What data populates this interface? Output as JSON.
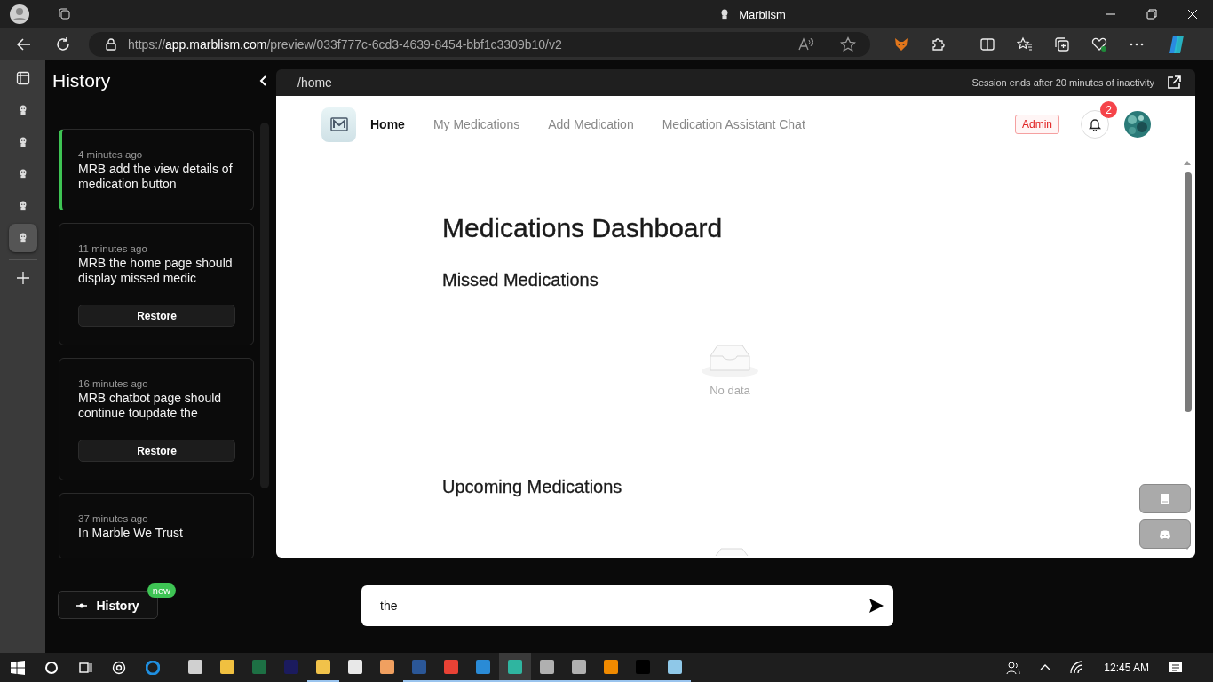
{
  "browser": {
    "tab_title": "Marblism",
    "url": {
      "scheme": "https://",
      "host": "app.marblism.com",
      "path": "/preview/033f777c-6cd3-4639-8454-bbf1c3309b10/v2"
    }
  },
  "vertical_tabs": [
    {
      "selected": false
    },
    {
      "selected": false
    },
    {
      "selected": false
    },
    {
      "selected": false
    },
    {
      "selected": true
    }
  ],
  "history": {
    "title": "History",
    "items": [
      {
        "time": "4 minutes ago",
        "text": "MRB add the view details of medication button",
        "selected": true
      },
      {
        "time": "11 minutes ago",
        "text": "MRB the home page should display missed medic",
        "selected": false,
        "button": "Restore"
      },
      {
        "time": "16 minutes ago",
        "text": "MRB chatbot page should continue toupdate the",
        "selected": false,
        "button": "Restore"
      },
      {
        "time": "37 minutes ago",
        "text": "In Marble We Trust",
        "selected": false
      }
    ]
  },
  "preview": {
    "path": "/home",
    "session_note": "Session ends after 20 minutes of inactivity",
    "nav": [
      {
        "label": "Home",
        "selected": true
      },
      {
        "label": "My Medications",
        "selected": false
      },
      {
        "label": "Add Medication",
        "selected": false
      },
      {
        "label": "Medication Assistant Chat",
        "selected": false
      }
    ],
    "role_badge": "Admin",
    "notification_count": "2",
    "title": "Medications Dashboard",
    "sections": [
      {
        "heading": "Missed Medications",
        "empty_text": "No data"
      },
      {
        "heading": "Upcoming Medications"
      }
    ]
  },
  "history_button": {
    "label": "History",
    "badge": "new"
  },
  "chat": {
    "value": "the"
  },
  "taskbar": {
    "apps": [
      {
        "kind": "calculator",
        "running": false,
        "selected": false
      },
      {
        "kind": "store",
        "running": false,
        "selected": false
      },
      {
        "kind": "excel",
        "running": false,
        "selected": false
      },
      {
        "kind": "photoshop",
        "running": false,
        "selected": false
      },
      {
        "kind": "folder",
        "running": true,
        "selected": false
      },
      {
        "kind": "mail",
        "running": false,
        "selected": false
      },
      {
        "kind": "scroll",
        "running": false,
        "selected": false
      },
      {
        "kind": "word",
        "running": true,
        "selected": false
      },
      {
        "kind": "chrome",
        "running": true,
        "selected": false
      },
      {
        "kind": "vscode",
        "running": true,
        "selected": false
      },
      {
        "kind": "edge",
        "running": true,
        "selected": true
      },
      {
        "kind": "git",
        "running": true,
        "selected": false
      },
      {
        "kind": "git",
        "running": true,
        "selected": false
      },
      {
        "kind": "cone",
        "running": true,
        "selected": false
      },
      {
        "kind": "ide",
        "running": true,
        "selected": false
      },
      {
        "kind": "notepad",
        "running": true,
        "selected": false
      }
    ],
    "time": "12:45 AM"
  }
}
